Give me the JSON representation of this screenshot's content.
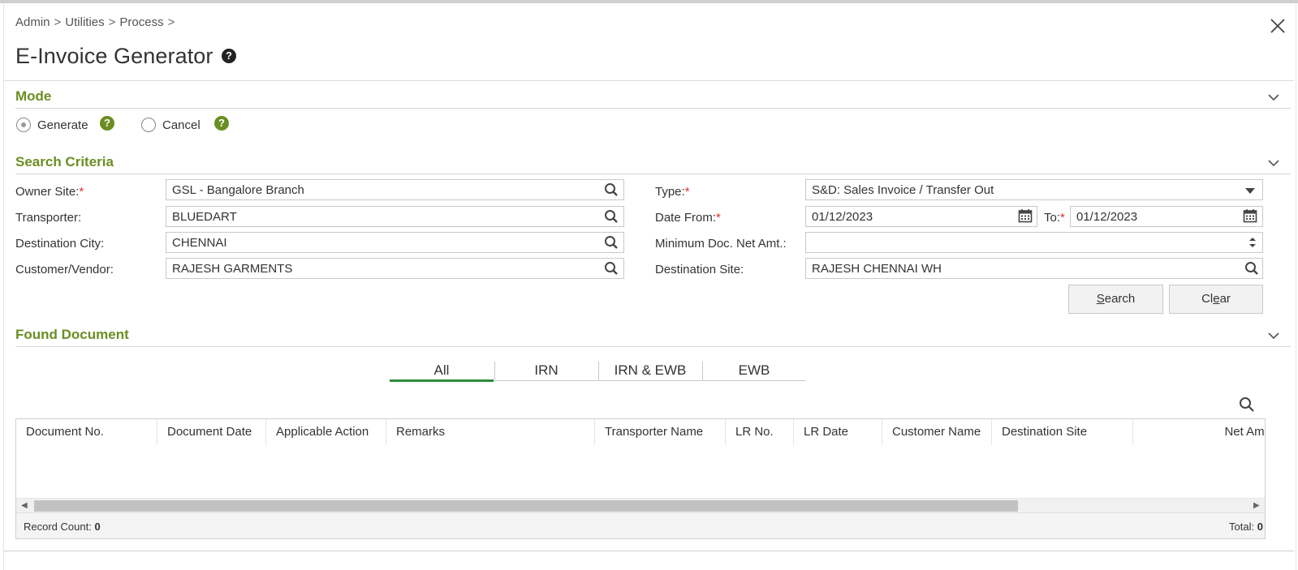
{
  "breadcrumb": [
    "Admin",
    "Utilities",
    "Process"
  ],
  "breadcrumb_separator": ">",
  "page": {
    "title": "E-Invoice Generator",
    "help_glyph": "?",
    "close_icon": "close-icon"
  },
  "mode": {
    "title": "Mode",
    "options": [
      {
        "label": "Generate",
        "selected": true
      },
      {
        "label": "Cancel",
        "selected": false
      }
    ],
    "help_glyph": "?"
  },
  "search": {
    "title": "Search Criteria",
    "owner_site": {
      "label": "Owner Site:",
      "required": "*",
      "value": "GSL - Bangalore Branch"
    },
    "transporter": {
      "label": "Transporter:",
      "value": "BLUEDART"
    },
    "destination_city": {
      "label": "Destination City:",
      "value": "CHENNAI"
    },
    "customer_vendor": {
      "label": "Customer/Vendor:",
      "value": "RAJESH GARMENTS"
    },
    "type": {
      "label": "Type:",
      "required": "*",
      "value": "S&D: Sales Invoice / Transfer Out"
    },
    "date_from": {
      "label": "Date From:",
      "required": "*",
      "value": "01/12/2023"
    },
    "date_to": {
      "label": "To:",
      "required": "*",
      "value": "01/12/2023"
    },
    "min_doc_amt": {
      "label": "Minimum Doc. Net Amt.:",
      "value": ""
    },
    "destination_site": {
      "label": "Destination Site:",
      "value": "RAJESH CHENNAI WH"
    },
    "search_button": {
      "label_first": "S",
      "label_rest": "earch"
    },
    "clear_button": {
      "label_first": "Cl",
      "label_underlined": "e",
      "label_rest": "ar"
    }
  },
  "found": {
    "title": "Found Document",
    "tabs": [
      {
        "label": "All",
        "active": true
      },
      {
        "label": "IRN",
        "active": false
      },
      {
        "label": "IRN & EWB",
        "active": false
      },
      {
        "label": "EWB",
        "active": false
      }
    ],
    "columns": [
      "Document No.",
      "Document Date",
      "Applicable Action",
      "Remarks",
      "Transporter Name",
      "LR No.",
      "LR Date",
      "Customer Name",
      "Destination Site",
      "Net Amo"
    ],
    "rows": [],
    "record_count_label": "Record Count:",
    "record_count": "0",
    "total_label": "Total:",
    "total_value": "0"
  },
  "colors": {
    "accent_green": "#6b8e23",
    "tab_active": "#2e8b3a",
    "required": "#e03030"
  }
}
